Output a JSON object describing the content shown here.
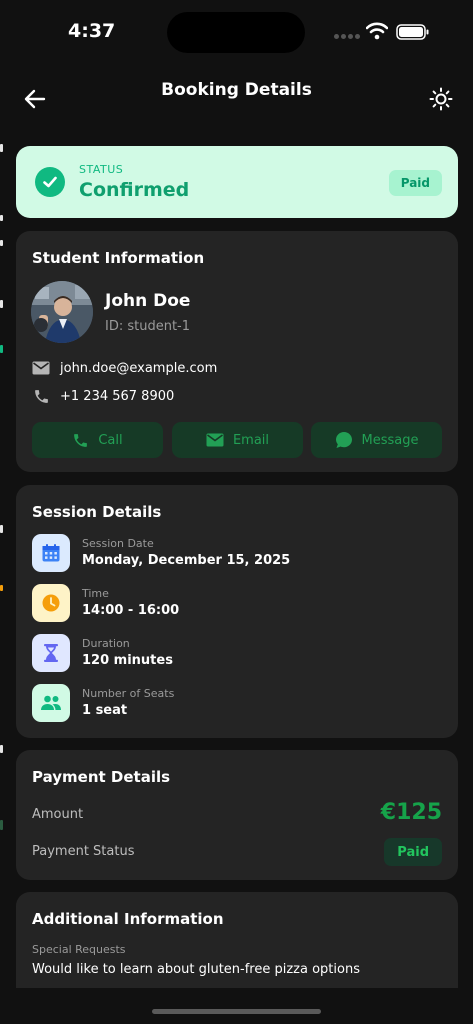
{
  "status_bar": {
    "time": "4:37"
  },
  "header": {
    "title": "Booking Details",
    "back_icon": "arrow-left-icon",
    "theme_icon": "sun-icon"
  },
  "status": {
    "label": "STATUS",
    "value": "Confirmed",
    "badge": "Paid"
  },
  "student": {
    "title": "Student Information",
    "name": "John Doe",
    "id": "ID: student-1",
    "email": "john.doe@example.com",
    "phone": "+1 234 567 8900",
    "actions": {
      "call": "Call",
      "email": "Email",
      "message": "Message"
    }
  },
  "session": {
    "title": "Session Details",
    "rows": [
      {
        "label": "Session Date",
        "value": "Monday, December 15, 2025",
        "icon": "calendar-icon"
      },
      {
        "label": "Time",
        "value": "14:00 - 16:00",
        "icon": "clock-icon"
      },
      {
        "label": "Duration",
        "value": "120 minutes",
        "icon": "hourglass-icon"
      },
      {
        "label": "Number of Seats",
        "value": "1 seat",
        "icon": "people-icon"
      }
    ]
  },
  "payment": {
    "title": "Payment Details",
    "amount_label": "Amount",
    "amount": "€125",
    "status_label": "Payment Status",
    "status": "Paid"
  },
  "additional": {
    "title": "Additional Information",
    "label": "Special Requests",
    "value": "Would like to learn about gluten-free pizza options"
  },
  "colors": {
    "background": "#111111",
    "card": "#242424",
    "status_card": "#d1fae5",
    "accent_green": "#10b981",
    "button_bg": "#163a26"
  }
}
